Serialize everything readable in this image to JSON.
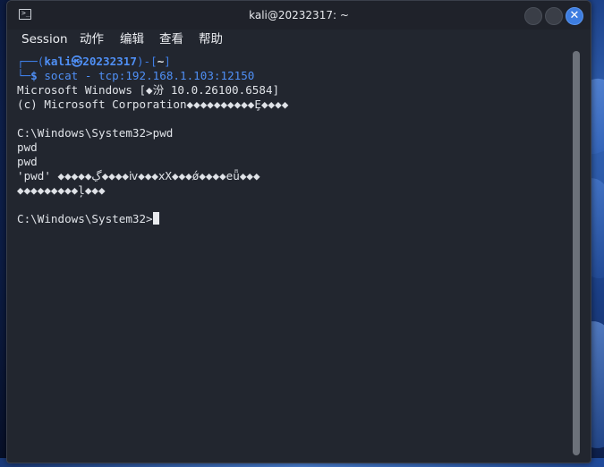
{
  "window": {
    "title": "kali@20232317: ~",
    "app_icon_glyph": ">_"
  },
  "menu": {
    "items": [
      "Session",
      "动作",
      "编辑",
      "查看",
      "帮助"
    ]
  },
  "prompt": {
    "open": "┌──(",
    "user_host": "kali㉿20232317",
    "mid": ")-[",
    "path": "~",
    "close": "]",
    "corner": "└─",
    "dollar": "$",
    "command": " socat - tcp:192.168.1.103:12150"
  },
  "output": {
    "line1": "Microsoft Windows [◆汾 10.0.26100.6584]",
    "line2": "(c) Microsoft Corporation◆◆◆◆◆◆◆◆◆◆Ȩ◆◆◆◆",
    "line3": "",
    "line4": "C:\\Windows\\System32>pwd",
    "line5": "pwd",
    "line6": "pwd",
    "line7": "'pwd' ◆◆◆◆◆ڲ◆◆◆◆ⅳ◆◆◆ⅹX◆◆◆ǿ◆◆◆◆eǖ◆◆◆",
    "line8": "◆◆◆◆◆◆◆◆◆ļ◆◆◆",
    "line9": "",
    "prompt_last": "C:\\Windows\\System32>"
  },
  "colors": {
    "terminal_bg": "#22262f",
    "prompt_blue": "#3f7fe8",
    "close_button": "#3d7de0"
  }
}
